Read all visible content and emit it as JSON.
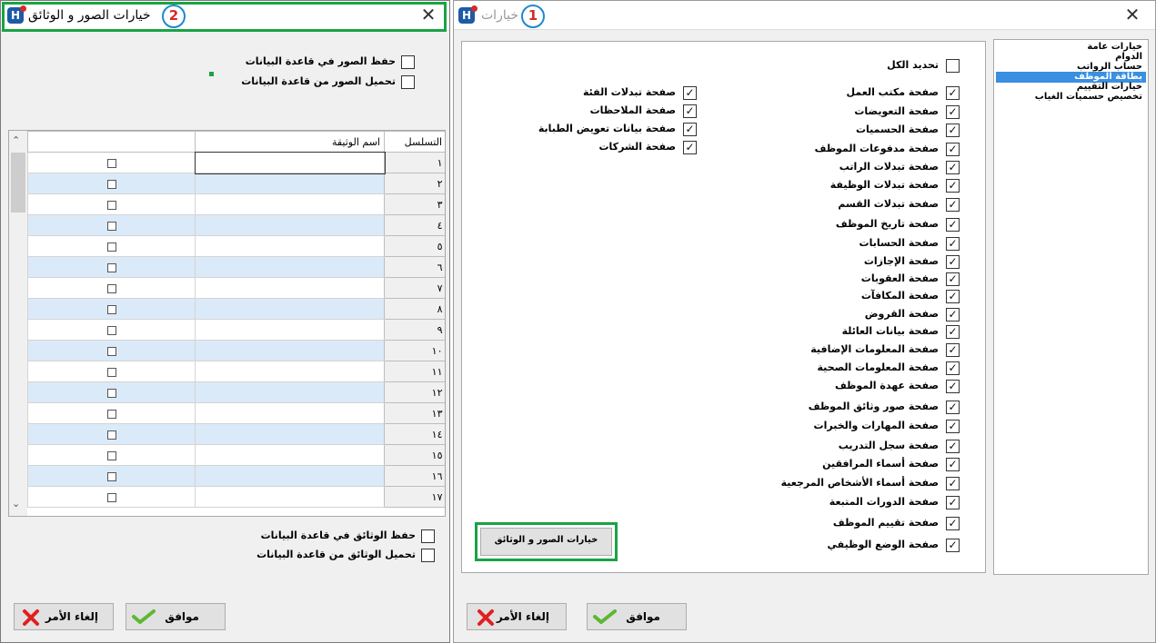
{
  "left_window": {
    "badge": "2",
    "title": "خيارات الصور و الوثائق",
    "image_options": [
      {
        "label": "حفظ الصور في قاعدة البيانات",
        "checked": false
      },
      {
        "label": "تحميل الصور من قاعدة البيانات",
        "checked": false
      }
    ],
    "grid": {
      "columns": {
        "seq": "التسلسل",
        "name": "اسم الوثيقة",
        "check": ""
      },
      "rows": [
        {
          "seq": "١"
        },
        {
          "seq": "٢"
        },
        {
          "seq": "٣"
        },
        {
          "seq": "٤"
        },
        {
          "seq": "٥"
        },
        {
          "seq": "٦"
        },
        {
          "seq": "٧"
        },
        {
          "seq": "٨"
        },
        {
          "seq": "٩"
        },
        {
          "seq": "١٠"
        },
        {
          "seq": "١١"
        },
        {
          "seq": "١٢"
        },
        {
          "seq": "١٣"
        },
        {
          "seq": "١٤"
        },
        {
          "seq": "١٥"
        },
        {
          "seq": "١٦"
        },
        {
          "seq": "١٧"
        }
      ]
    },
    "document_options": [
      {
        "label": "حفظ الوثائق في قاعدة البيانات",
        "checked": false
      },
      {
        "label": "تحميل الوثائق من قاعدة البيانات",
        "checked": false
      }
    ],
    "ok_label": "موافق",
    "cancel_label": "إلغاء الأمر"
  },
  "right_window": {
    "badge": "1",
    "title": "خيارات",
    "sidebar": [
      {
        "label": "خيارات عامة",
        "selected": false
      },
      {
        "label": "الدوام",
        "selected": false
      },
      {
        "label": "حساب الرواتب",
        "selected": false
      },
      {
        "label": "بطاقة الموظف",
        "selected": true
      },
      {
        "label": "خيارات التقييم",
        "selected": false
      },
      {
        "label": "تخصيص حسميات الغياب",
        "selected": false
      }
    ],
    "select_all": {
      "label": "تحديد الكل",
      "checked": false
    },
    "pages_col1": [
      {
        "label": "صفحة مكتب العمل",
        "checked": true
      },
      {
        "label": "صفحة التعويضات",
        "checked": true
      },
      {
        "label": "صفحة الحسميات",
        "checked": true
      },
      {
        "label": "صفحة مدفوعات الموظف",
        "checked": true
      },
      {
        "label": "صفحة تبدلات الراتب",
        "checked": true
      },
      {
        "label": "صفحة تبدلات الوظيفة",
        "checked": true
      },
      {
        "label": "صفحة تبدلات القسم",
        "checked": true
      },
      {
        "label": "صفحة تاريخ الموظف",
        "checked": true
      },
      {
        "label": "صفحة الحسابات",
        "checked": true
      },
      {
        "label": "صفحة الإجازات",
        "checked": true
      },
      {
        "label": "صفحة العقوبات",
        "checked": true
      },
      {
        "label": "صفحة المكافآت",
        "checked": true
      },
      {
        "label": "صفحة القروض",
        "checked": true
      },
      {
        "label": "صفحة بيانات العائلة",
        "checked": true
      },
      {
        "label": "صفحة المعلومات الإضافية",
        "checked": true
      },
      {
        "label": "صفحة المعلومات الصحية",
        "checked": true
      },
      {
        "label": "صفحة عهدة الموظف",
        "checked": true
      },
      {
        "label": "صفحة صور وثائق الموظف",
        "checked": true
      },
      {
        "label": "صفحة المهارات والخبرات",
        "checked": true
      },
      {
        "label": "صفحة سجل التدريب",
        "checked": true
      },
      {
        "label": "صفحة أسماء المرافقين",
        "checked": true
      },
      {
        "label": "صفحة أسماء الأشخاص المرجعية",
        "checked": true
      },
      {
        "label": "صفحة الدورات المتبعة",
        "checked": true
      },
      {
        "label": "صفحة تقييم الموظف",
        "checked": true
      },
      {
        "label": "صفحة الوضع الوظيفي",
        "checked": true
      }
    ],
    "pages_col2": [
      {
        "label": "صفحة تبدلات الفئة",
        "checked": true
      },
      {
        "label": "صفحة الملاحظات",
        "checked": true
      },
      {
        "label": "صفحة بيانات تعويض الطبابة",
        "checked": true
      },
      {
        "label": "صفحة الشركات",
        "checked": true
      }
    ],
    "image_options_button": "خيارات الصور و الوثائق",
    "ok_label": "موافق",
    "cancel_label": "إلغاء الأمر"
  },
  "colors": {
    "highlight_green": "#1aa344",
    "badge_blue": "#1e88d0",
    "badge_red": "#d42a2a",
    "row_alt": "#dbeaf8",
    "selected_item": "#3a8fe0"
  }
}
